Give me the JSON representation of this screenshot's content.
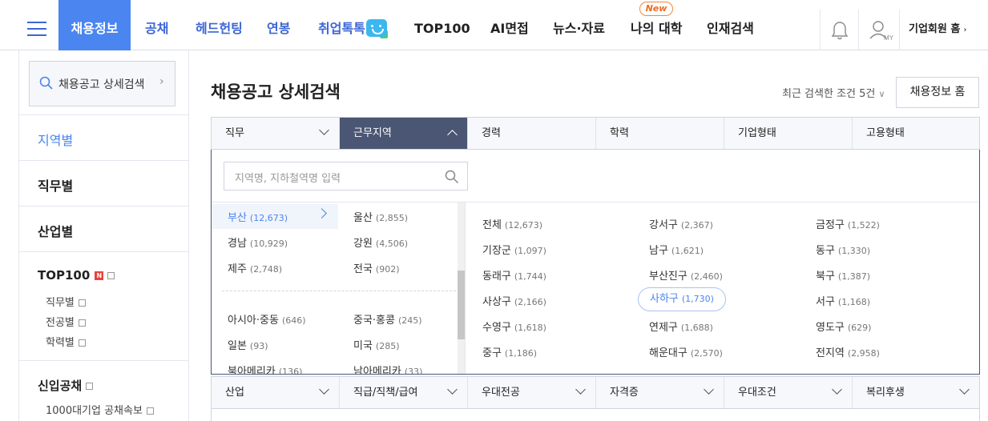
{
  "nav": {
    "items": [
      "채용정보",
      "공채",
      "헤드헌팅",
      "연봉",
      "취업톡톡",
      "TOP100",
      "AI면접",
      "뉴스·자료",
      "나의 대학",
      "인재검색"
    ],
    "new_badge": "New",
    "my_label": "MY",
    "corp_home": "기업회원 홈"
  },
  "sidebar": {
    "search_label": "채용공고 상세검색",
    "sections": [
      "지역별",
      "직무별",
      "산업별",
      "TOP100"
    ],
    "top100_sub": [
      "직무별",
      "전공별",
      "학력별"
    ],
    "new_badge": "N",
    "gongchae_title": "신입공채",
    "gongchae_sub": "1000대기업 공채속보"
  },
  "main": {
    "title": "채용공고 상세검색",
    "recent": "최근 검색한 조건 5건",
    "home_button": "채용정보 홈",
    "tabs1": [
      "직무",
      "근무지역",
      "경력",
      "학력",
      "기업형태",
      "고용형태"
    ],
    "tabs2": [
      "산업",
      "직급/직책/급여",
      "우대전공",
      "자격증",
      "우대조건",
      "복리후생"
    ],
    "search_placeholder": "지역명, 지하철역명 입력",
    "regions_left": [
      {
        "name": "부산",
        "count": "(12,673)"
      },
      {
        "name": "경남",
        "count": "(10,929)"
      },
      {
        "name": "제주",
        "count": "(2,748)"
      },
      {
        "name": "아시아·중동",
        "count": "(646)"
      },
      {
        "name": "일본",
        "count": "(93)"
      },
      {
        "name": "북아메리카",
        "count": "(136)"
      }
    ],
    "regions_right": [
      {
        "name": "울산",
        "count": "(2,855)"
      },
      {
        "name": "강원",
        "count": "(4,506)"
      },
      {
        "name": "전국",
        "count": "(902)"
      },
      {
        "name": "중국·홍콩",
        "count": "(245)"
      },
      {
        "name": "미국",
        "count": "(285)"
      },
      {
        "name": "남아메리카",
        "count": "(33)"
      }
    ],
    "districts": [
      {
        "name": "전체",
        "count": "(12,673)"
      },
      {
        "name": "강서구",
        "count": "(2,367)"
      },
      {
        "name": "금정구",
        "count": "(1,522)"
      },
      {
        "name": "기장군",
        "count": "(1,097)"
      },
      {
        "name": "남구",
        "count": "(1,621)"
      },
      {
        "name": "동구",
        "count": "(1,330)"
      },
      {
        "name": "동래구",
        "count": "(1,744)"
      },
      {
        "name": "부산진구",
        "count": "(2,460)"
      },
      {
        "name": "북구",
        "count": "(1,387)"
      },
      {
        "name": "사상구",
        "count": "(2,166)"
      },
      {
        "name": "사하구",
        "count": "(1,730)"
      },
      {
        "name": "서구",
        "count": "(1,168)"
      },
      {
        "name": "수영구",
        "count": "(1,618)"
      },
      {
        "name": "연제구",
        "count": "(1,688)"
      },
      {
        "name": "영도구",
        "count": "(629)"
      },
      {
        "name": "중구",
        "count": "(1,186)"
      },
      {
        "name": "해운대구",
        "count": "(2,570)"
      },
      {
        "name": "전지역",
        "count": "(2,958)"
      }
    ]
  },
  "colors": {
    "accent": "#4a85f0",
    "active_tab": "#4a5673"
  }
}
